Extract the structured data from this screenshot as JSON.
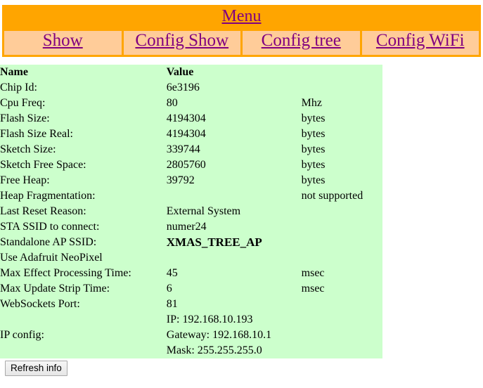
{
  "menu": {
    "title": "Menu",
    "items": [
      {
        "label": "Show"
      },
      {
        "label": "Config Show"
      },
      {
        "label": "Config tree"
      },
      {
        "label": "Config WiFi"
      }
    ]
  },
  "info": {
    "headers": {
      "name": "Name",
      "value": "Value",
      "unit": ""
    },
    "rows": [
      {
        "name": "Chip Id:",
        "value": "6e3196",
        "unit": ""
      },
      {
        "name": "Cpu Freq:",
        "value": "80",
        "unit": "Mhz"
      },
      {
        "name": "Flash Size:",
        "value": "4194304",
        "unit": "bytes"
      },
      {
        "name": "Flash Size Real:",
        "value": "4194304",
        "unit": "bytes"
      },
      {
        "name": "Sketch Size:",
        "value": "339744",
        "unit": "bytes"
      },
      {
        "name": "Sketch Free Space:",
        "value": "2805760",
        "unit": "bytes"
      },
      {
        "name": "Free Heap:",
        "value": "39792",
        "unit": "bytes"
      },
      {
        "name": "Heap Fragmentation:",
        "value": "",
        "unit": "not supported"
      },
      {
        "name": "Last Reset Reason:",
        "value": "External System",
        "unit": ""
      },
      {
        "name": "STA SSID to connect:",
        "value": "numer24",
        "unit": ""
      },
      {
        "name": "Standalone AP SSID:",
        "value": "XMAS_TREE_AP",
        "unit": "",
        "bold_value": true
      },
      {
        "name": "Use Adafruit NeoPixel",
        "value": "",
        "unit": ""
      },
      {
        "name": "Max Effect Processing Time:",
        "value": "45",
        "unit": "msec"
      },
      {
        "name": "Max Update Strip Time:",
        "value": "6",
        "unit": "msec"
      },
      {
        "name": "WebSockets Port:",
        "value": "81",
        "unit": ""
      }
    ],
    "ip_config": {
      "name": "IP config:",
      "line1": "IP: 192.168.10.193",
      "line2": "Gateway: 192.168.10.1",
      "line3": "Mask: 255.255.255.0",
      "unit": ""
    }
  },
  "actions": {
    "refresh_label": "Refresh info"
  },
  "colors": {
    "menu_bar": "#ffa500",
    "menu_cell": "#ffcc99",
    "link": "#800080",
    "panel": "#ccffcc",
    "text": "#000000"
  }
}
